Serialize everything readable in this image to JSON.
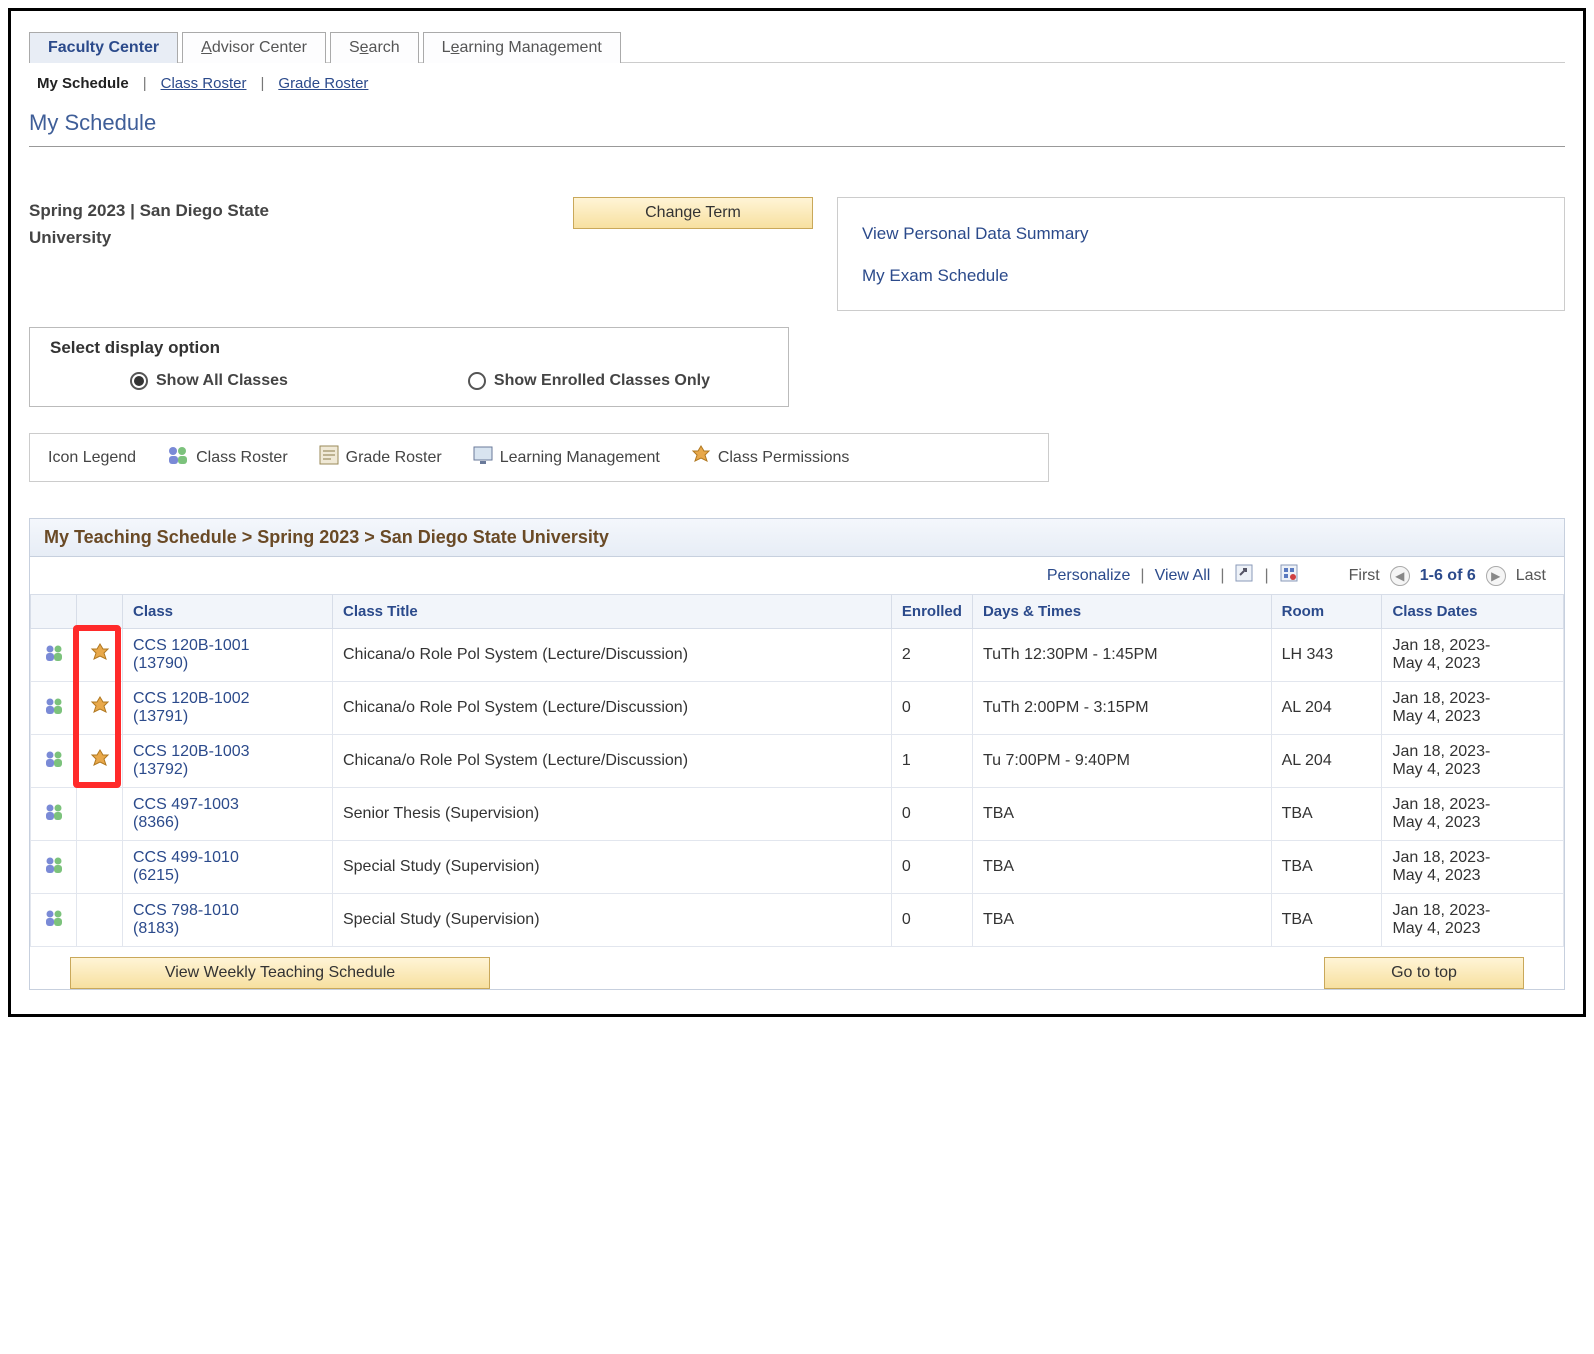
{
  "tabs": {
    "faculty_center": "Faculty Center",
    "advisor_center": "Advisor Center",
    "search": "Search",
    "learning_mgmt": "Learning Management"
  },
  "subtabs": {
    "my_schedule": "My Schedule",
    "class_roster": "Class Roster",
    "grade_roster": "Grade Roster"
  },
  "page_title": "My Schedule",
  "term_line": "Spring 2023 | San Diego State University",
  "buttons": {
    "change_term": "Change Term",
    "view_weekly": "View Weekly Teaching Schedule",
    "go_top": "Go to top"
  },
  "side_links": {
    "personal_data": "View Personal Data Summary",
    "exam_schedule": "My Exam Schedule"
  },
  "display_option": {
    "title": "Select display option",
    "show_all": "Show All Classes",
    "show_enrolled": "Show Enrolled Classes Only"
  },
  "legend": {
    "title": "Icon Legend",
    "class_roster": "Class Roster",
    "grade_roster": "Grade Roster",
    "learning_mgmt": "Learning Management",
    "class_permissions": "Class Permissions"
  },
  "schedule": {
    "heading": "My Teaching Schedule > Spring 2023 > San Diego State University",
    "toolbar": {
      "personalize": "Personalize",
      "view_all": "View All",
      "first": "First",
      "range": "1-6 of 6",
      "last": "Last"
    },
    "columns": {
      "class": "Class",
      "class_title": "Class Title",
      "enrolled": "Enrolled",
      "days_times": "Days & Times",
      "room": "Room",
      "class_dates": "Class Dates"
    },
    "rows": [
      {
        "has_perm": true,
        "class_line1": "CCS 120B-1001",
        "class_line2": "(13790)",
        "title": "Chicana/o Role Pol System (Lecture/Discussion)",
        "enrolled": "2",
        "days": "TuTh 12:30PM - 1:45PM",
        "room": "LH 343",
        "dates": "Jan 18, 2023-May 4, 2023"
      },
      {
        "has_perm": true,
        "class_line1": "CCS 120B-1002",
        "class_line2": "(13791)",
        "title": "Chicana/o Role Pol System (Lecture/Discussion)",
        "enrolled": "0",
        "days": "TuTh 2:00PM - 3:15PM",
        "room": "AL 204",
        "dates": "Jan 18, 2023-May 4, 2023"
      },
      {
        "has_perm": true,
        "class_line1": "CCS 120B-1003",
        "class_line2": "(13792)",
        "title": "Chicana/o Role Pol System (Lecture/Discussion)",
        "enrolled": "1",
        "days": "Tu 7:00PM - 9:40PM",
        "room": "AL 204",
        "dates": "Jan 18, 2023-May 4, 2023"
      },
      {
        "has_perm": false,
        "class_line1": "CCS 497-1003",
        "class_line2": "(8366)",
        "title": "Senior Thesis (Supervision)",
        "enrolled": "0",
        "days": "TBA",
        "room": "TBA",
        "dates": "Jan 18, 2023-May 4, 2023"
      },
      {
        "has_perm": false,
        "class_line1": "CCS 499-1010",
        "class_line2": "(6215)",
        "title": "Special Study (Supervision)",
        "enrolled": "0",
        "days": "TBA",
        "room": "TBA",
        "dates": "Jan 18, 2023-May 4, 2023"
      },
      {
        "has_perm": false,
        "class_line1": "CCS 798-1010",
        "class_line2": "(8183)",
        "title": "Special Study (Supervision)",
        "enrolled": "0",
        "days": "TBA",
        "room": "TBA",
        "dates": "Jan 18, 2023-May 4, 2023"
      }
    ]
  }
}
